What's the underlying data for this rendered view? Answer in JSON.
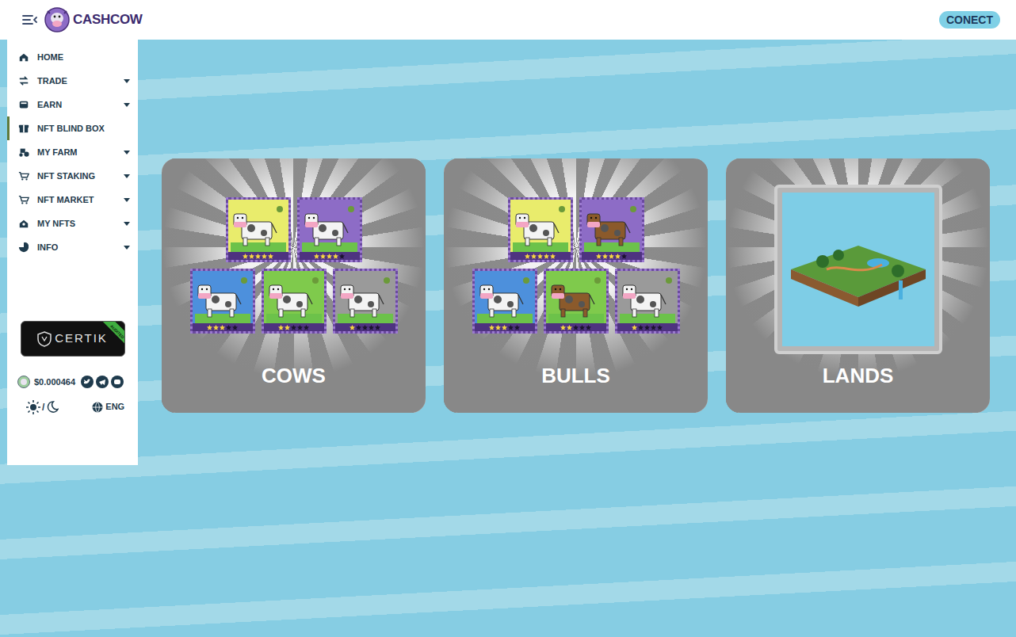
{
  "header": {
    "logo_text": "CASHCOW",
    "connect_button": "CONECT"
  },
  "sidebar": {
    "items": [
      {
        "label": "HOME",
        "expandable": false,
        "selected": false
      },
      {
        "label": "TRADE",
        "expandable": true,
        "selected": false
      },
      {
        "label": "EARN",
        "expandable": true,
        "selected": false
      },
      {
        "label": "NFT BLIND BOX",
        "expandable": false,
        "selected": true
      },
      {
        "label": "MY FARM",
        "expandable": true,
        "selected": false
      },
      {
        "label": "NFT STAKING",
        "expandable": true,
        "selected": false
      },
      {
        "label": "NFT MARKET",
        "expandable": true,
        "selected": false
      },
      {
        "label": "MY NFTS",
        "expandable": true,
        "selected": false
      },
      {
        "label": "INFO",
        "expandable": true,
        "selected": false
      }
    ],
    "certik": {
      "label": "CERTIK",
      "ribbon": "AUDITED"
    },
    "price": "$0.000464",
    "theme_separator": "/",
    "language": "ENG"
  },
  "categories": [
    {
      "title": "COWS",
      "kind": "animals",
      "nfts": [
        {
          "stars": 5,
          "color": "#e9ec6c"
        },
        {
          "stars": 4,
          "color": "#8d6cc6"
        },
        {
          "stars": 3,
          "color": "#4d90dc"
        },
        {
          "stars": 2,
          "color": "#7fca4c"
        },
        {
          "stars": 1,
          "color": "#9a9a9a"
        }
      ]
    },
    {
      "title": "BULLS",
      "kind": "animals",
      "nfts": [
        {
          "stars": 5,
          "color": "#e9ec6c"
        },
        {
          "stars": 4,
          "color": "#8d6cc6"
        },
        {
          "stars": 3,
          "color": "#4d90dc"
        },
        {
          "stars": 2,
          "color": "#7fca4c"
        },
        {
          "stars": 1,
          "color": "#9a9a9a"
        }
      ]
    },
    {
      "title": "LANDS",
      "kind": "land",
      "nfts": []
    }
  ]
}
